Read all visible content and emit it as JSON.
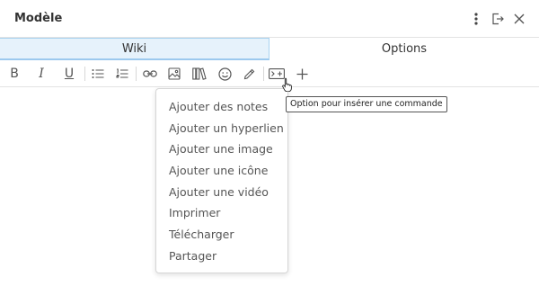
{
  "header": {
    "title": "Modèle",
    "icons": [
      "more-vertical-icon",
      "exit-icon",
      "close-icon"
    ]
  },
  "tabs": [
    {
      "label": "Wiki",
      "active": true
    },
    {
      "label": "Options",
      "active": false
    }
  ],
  "toolbar": {
    "bold_label": "B",
    "italic_label": "I",
    "underline_label": "U",
    "buttons": [
      "bold",
      "italic",
      "underline",
      "bullet-list",
      "numbered-list",
      "link",
      "image",
      "library",
      "emoji",
      "pencil",
      "command",
      "plus"
    ]
  },
  "menu": {
    "items": [
      "Ajouter des notes",
      "Ajouter un hyperlien",
      "Ajouter une image",
      "Ajouter une icône",
      "Ajouter une vidéo",
      "Imprimer",
      "Télécharger",
      "Partager"
    ]
  },
  "tooltip": {
    "text": "Option pour insérer une commande"
  },
  "colors": {
    "active_tab_bg": "#e6f2fb",
    "active_tab_border": "#9cc9ee",
    "text": "#333333"
  }
}
